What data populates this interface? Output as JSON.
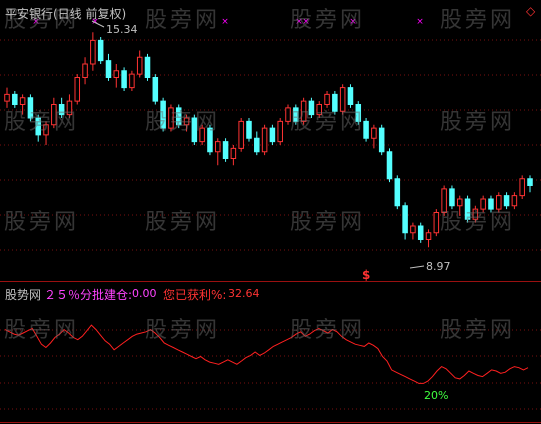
{
  "main_panel": {
    "title": "平安银行(日线 前复权)",
    "high_label": "15.34",
    "low_label": "8.97",
    "signal_marker": "$",
    "corner_marker": "◇"
  },
  "sub_panel": {
    "name": "股势网",
    "indicator_label": "２５％分批建仓:",
    "indicator_value": "0.00",
    "profit_label": "您已获利%:",
    "profit_value": "32.64",
    "line_annotation": "20%"
  },
  "watermark": "股旁网",
  "colors": {
    "background": "#000000",
    "up_candle": "#ff3333",
    "down_candle": "#54ffff",
    "grid": "#7a1010",
    "title": "#c0c0c0",
    "indicator_label": "#ff44ff",
    "profit_label": "#ff3333",
    "line": "#ff2020",
    "green_annotation": "#40ff40",
    "x_marker": "#ff00ff"
  },
  "chart_data": [
    {
      "type": "candlestick",
      "title": "平安银行(日线 前复权)",
      "ylim": [
        8,
        16
      ],
      "annotations": [
        {
          "text": "15.34",
          "type": "high"
        },
        {
          "text": "8.97",
          "type": "low"
        }
      ],
      "series": [
        {
          "name": "",
          "ohlc": [
            [
              13.3,
              13.7,
              13.1,
              13.5
            ],
            [
              13.5,
              13.6,
              13.1,
              13.2
            ],
            [
              13.2,
              13.5,
              12.9,
              13.4
            ],
            [
              13.4,
              13.5,
              12.7,
              12.8
            ],
            [
              12.8,
              12.9,
              12.1,
              12.3
            ],
            [
              12.3,
              12.7,
              12.0,
              12.6
            ],
            [
              12.6,
              13.4,
              12.5,
              13.2
            ],
            [
              13.2,
              13.4,
              12.8,
              12.9
            ],
            [
              12.9,
              13.5,
              12.8,
              13.3
            ],
            [
              13.3,
              14.1,
              13.2,
              14.0
            ],
            [
              14.0,
              14.6,
              13.8,
              14.4
            ],
            [
              14.4,
              15.34,
              14.2,
              15.1
            ],
            [
              15.1,
              15.2,
              14.4,
              14.5
            ],
            [
              14.5,
              14.7,
              13.9,
              14.0
            ],
            [
              14.0,
              14.4,
              13.7,
              14.2
            ],
            [
              14.2,
              14.3,
              13.6,
              13.7
            ],
            [
              13.7,
              14.2,
              13.6,
              14.1
            ],
            [
              14.1,
              14.8,
              14.0,
              14.6
            ],
            [
              14.6,
              14.7,
              13.9,
              14.0
            ],
            [
              14.0,
              14.1,
              13.2,
              13.3
            ],
            [
              13.3,
              13.4,
              12.4,
              12.5
            ],
            [
              12.5,
              13.2,
              12.4,
              13.1
            ],
            [
              13.1,
              13.2,
              12.5,
              12.6
            ],
            [
              12.6,
              12.9,
              12.4,
              12.8
            ],
            [
              12.8,
              12.9,
              12.0,
              12.1
            ],
            [
              12.1,
              12.6,
              12.0,
              12.5
            ],
            [
              12.5,
              12.6,
              11.7,
              11.8
            ],
            [
              11.8,
              12.2,
              11.4,
              12.1
            ],
            [
              12.1,
              12.2,
              11.5,
              11.6
            ],
            [
              11.6,
              12.0,
              11.4,
              11.9
            ],
            [
              11.9,
              12.8,
              11.8,
              12.7
            ],
            [
              12.7,
              12.8,
              12.1,
              12.2
            ],
            [
              12.2,
              12.4,
              11.7,
              11.8
            ],
            [
              11.8,
              12.6,
              11.7,
              12.5
            ],
            [
              12.5,
              12.6,
              12.0,
              12.1
            ],
            [
              12.1,
              12.8,
              12.0,
              12.7
            ],
            [
              12.7,
              13.2,
              12.6,
              13.1
            ],
            [
              13.1,
              13.2,
              12.6,
              12.7
            ],
            [
              12.7,
              13.4,
              12.6,
              13.3
            ],
            [
              13.3,
              13.4,
              12.8,
              12.9
            ],
            [
              12.9,
              13.3,
              12.8,
              13.2
            ],
            [
              13.2,
              13.6,
              13.1,
              13.5
            ],
            [
              13.5,
              13.6,
              12.9,
              13.0
            ],
            [
              13.0,
              13.8,
              12.9,
              13.7
            ],
            [
              13.7,
              13.8,
              13.1,
              13.2
            ],
            [
              13.2,
              13.3,
              12.6,
              12.7
            ],
            [
              12.7,
              12.8,
              12.1,
              12.2
            ],
            [
              12.2,
              12.6,
              11.9,
              12.5
            ],
            [
              12.5,
              12.6,
              11.7,
              11.8
            ],
            [
              11.8,
              11.9,
              10.9,
              11.0
            ],
            [
              11.0,
              11.1,
              10.1,
              10.2
            ],
            [
              10.2,
              10.3,
              9.2,
              9.4
            ],
            [
              9.4,
              9.7,
              9.2,
              9.6
            ],
            [
              9.6,
              9.7,
              9.1,
              9.2
            ],
            [
              9.2,
              9.5,
              8.97,
              9.4
            ],
            [
              9.4,
              10.1,
              9.3,
              10.0
            ],
            [
              10.0,
              10.8,
              9.9,
              10.7
            ],
            [
              10.7,
              10.8,
              10.1,
              10.2
            ],
            [
              10.2,
              10.5,
              9.9,
              10.4
            ],
            [
              10.4,
              10.5,
              9.7,
              9.8
            ],
            [
              9.8,
              10.2,
              9.7,
              10.1
            ],
            [
              10.1,
              10.5,
              10.0,
              10.4
            ],
            [
              10.4,
              10.5,
              10.0,
              10.1
            ],
            [
              10.1,
              10.6,
              10.0,
              10.5
            ],
            [
              10.5,
              10.6,
              10.1,
              10.2
            ],
            [
              10.2,
              10.6,
              10.1,
              10.5
            ],
            [
              10.5,
              11.1,
              10.4,
              11.0
            ],
            [
              11.0,
              11.1,
              10.6,
              10.8
            ]
          ]
        }
      ]
    },
    {
      "type": "line",
      "title": "",
      "series": [
        {
          "name": "",
          "values": [
            70,
            68,
            66,
            65,
            67,
            69,
            71,
            64,
            57,
            54,
            58,
            63,
            66,
            70,
            67,
            63,
            61,
            64,
            69,
            74,
            70,
            65,
            60,
            57,
            52,
            55,
            58,
            61,
            64,
            66,
            67,
            68,
            70,
            67,
            63,
            58,
            56,
            54,
            52,
            50,
            48,
            46,
            44,
            46,
            43,
            41,
            40,
            39,
            41,
            43,
            41,
            39,
            42,
            45,
            47,
            50,
            47,
            49,
            52,
            55,
            57,
            59,
            61,
            63,
            66,
            68,
            64,
            66,
            69,
            71,
            69,
            67,
            70,
            68,
            64,
            61,
            59,
            57,
            56,
            55,
            58,
            56,
            53,
            46,
            42,
            34,
            32,
            30,
            28,
            26,
            24,
            22,
            22,
            24,
            28,
            33,
            37,
            35,
            31,
            27,
            26,
            29,
            33,
            31,
            29,
            28,
            31,
            34,
            33,
            31,
            32,
            35,
            37,
            36,
            34,
            36
          ]
        }
      ]
    }
  ]
}
